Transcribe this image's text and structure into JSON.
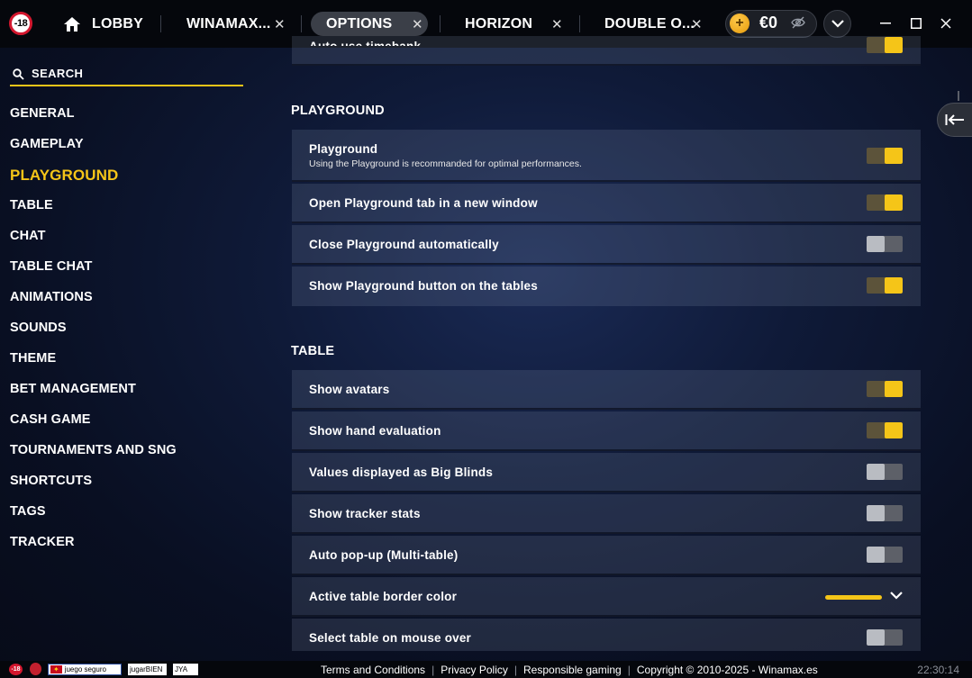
{
  "topbar": {
    "age_badge": "-18",
    "tabs": [
      {
        "label": "LOBBY",
        "icon": "home-icon"
      },
      {
        "label": "WINAMAX..."
      },
      {
        "label": "OPTIONS"
      },
      {
        "label": "HORIZON"
      },
      {
        "label": "DOUBLE O..."
      }
    ],
    "close_glyph": "✕",
    "coin_glyph": "+",
    "balance": "€0"
  },
  "sidebar": {
    "search_label": "SEARCH",
    "items": [
      {
        "label": "GENERAL"
      },
      {
        "label": "GAMEPLAY"
      },
      {
        "label": "PLAYGROUND"
      },
      {
        "label": "TABLE"
      },
      {
        "label": "CHAT"
      },
      {
        "label": "TABLE CHAT"
      },
      {
        "label": "ANIMATIONS"
      },
      {
        "label": "SOUNDS"
      },
      {
        "label": "THEME"
      },
      {
        "label": "BET MANAGEMENT"
      },
      {
        "label": "CASH GAME"
      },
      {
        "label": "TOURNAMENTS AND SNG"
      },
      {
        "label": "SHORTCUTS"
      },
      {
        "label": "TAGS"
      },
      {
        "label": "TRACKER"
      }
    ],
    "active": "PLAYGROUND"
  },
  "main": {
    "top_partial_row": {
      "label": "Auto use timebank",
      "on": true
    },
    "sections": [
      {
        "title": "PLAYGROUND",
        "rows": [
          {
            "label": "Playground",
            "sub": "Using the Playground is recommanded for optimal performances.",
            "on": true
          },
          {
            "label": "Open Playground tab in a new window",
            "on": true
          },
          {
            "label": "Close Playground automatically",
            "on": false
          },
          {
            "label": "Show Playground button on the tables",
            "on": true
          }
        ]
      },
      {
        "title": "TABLE",
        "rows": [
          {
            "label": "Show avatars",
            "on": true
          },
          {
            "label": "Show hand evaluation",
            "on": true
          },
          {
            "label": "Values displayed as Big Blinds",
            "on": false
          },
          {
            "label": "Show tracker stats",
            "on": false
          },
          {
            "label": "Auto pop-up (Multi-table)",
            "on": false
          },
          {
            "label": "Active table border color",
            "type": "color",
            "color": "#f5c518"
          },
          {
            "label": "Select table on mouse over",
            "on": false
          }
        ]
      }
    ]
  },
  "footer": {
    "age": "-18",
    "logos": [
      "juego seguro",
      "jugarBIEN",
      "JYA"
    ],
    "links": [
      "Terms and Conditions",
      "Privacy Policy",
      "Responsible gaming",
      "Copyright © 2010-2025 - Winamax.es"
    ],
    "clock": "22:30:14"
  },
  "colors": {
    "accent": "#f5c518",
    "danger": "#d3172e"
  }
}
